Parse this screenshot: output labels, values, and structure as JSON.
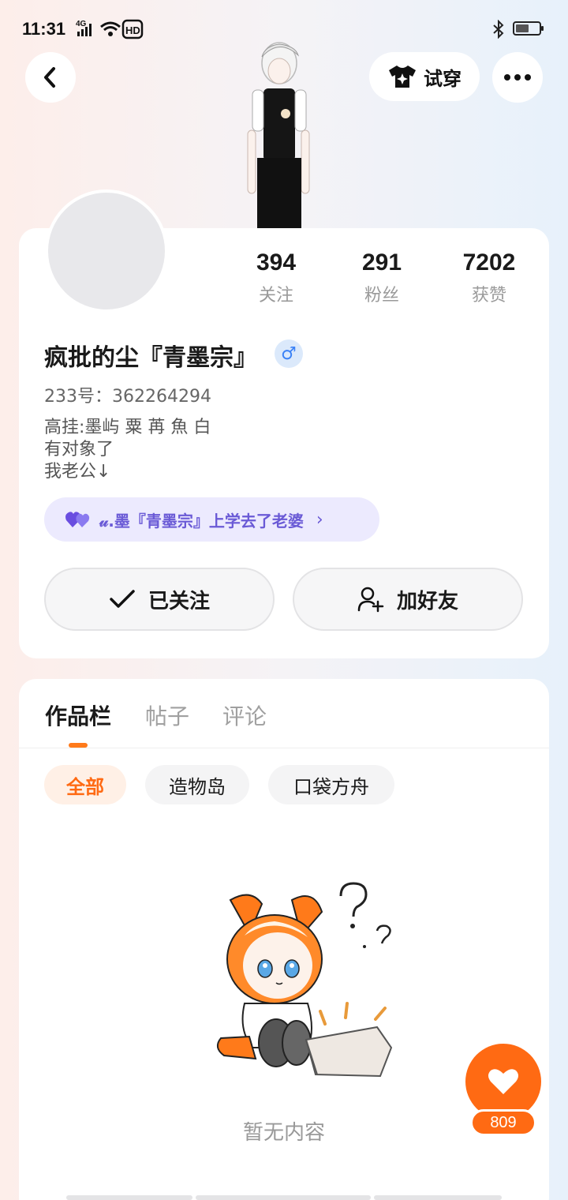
{
  "status_bar": {
    "time": "11:31",
    "network": "4G",
    "hd": "HD"
  },
  "header": {
    "back_icon": "chevron-left-icon",
    "tryon_icon": "tshirt-icon",
    "tryon_label": "试穿",
    "more_icon": "more-horizontal-icon"
  },
  "profile": {
    "stats": [
      {
        "value": "394",
        "label": "关注"
      },
      {
        "value": "291",
        "label": "粉丝"
      },
      {
        "value": "7202",
        "label": "获赞"
      }
    ],
    "username": "疯批的尘『青墨宗』",
    "gender": "♂",
    "uid": "233号：362264294",
    "bio_lines": [
      "高挂:墨屿  粟 苒  魚  白",
      "有对象了",
      "我老公↓"
    ],
    "relation": {
      "icon": "double-heart-icon",
      "text": "𝓊.墨『青墨宗』上学去了老婆",
      "chevron": "›"
    },
    "follow_label": "已关注",
    "add_friend_label": "加好友"
  },
  "works": {
    "tabs": [
      "作品栏",
      "帖子",
      "评论"
    ],
    "filters": [
      "全部",
      "造物岛",
      "口袋方舟"
    ],
    "empty_text": "暂无内容"
  },
  "like": {
    "count": "809"
  },
  "colors": {
    "accent": "#ff6a13",
    "relation_bg": "#eceafe",
    "relation_text": "#6a5ad6",
    "gender_blue": "#3b82f6"
  }
}
